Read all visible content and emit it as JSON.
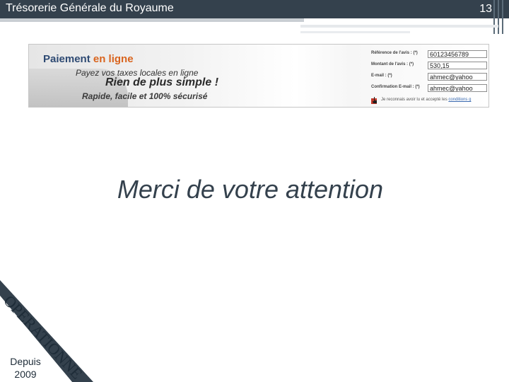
{
  "header": {
    "title": "Trésorerie Générale du Royaume",
    "page_number": "13"
  },
  "banner": {
    "title_main": "Paiement",
    "title_accent": "en ligne",
    "line1": "Payez vos taxes locales en ligne",
    "line2": "Rien de plus simple !",
    "line3": "Rapide, facile et 100% sécurisé",
    "form": {
      "fields": [
        {
          "label": "Référence de l'avis : (*)",
          "value": "60123456789"
        },
        {
          "label": "Montant de l'avis : (*)",
          "value": "530,15"
        },
        {
          "label": "E-mail : (*)",
          "value": "ahmec@yahoo"
        },
        {
          "label": "Confirmation E-mail : (*)",
          "value": "ahmec@yahoo"
        }
      ],
      "terms_text": "Je reconnais avoir lu et accepté les",
      "terms_link": "conditions g"
    }
  },
  "main": {
    "thanks": "Merci de votre attention"
  },
  "ribbon": {
    "text": "OPERATIONNEL",
    "since": "Depuis",
    "year": "2009",
    "color": "#34414d"
  },
  "colors": {
    "header_bg": "#34414d",
    "accent_orange": "#d9641e",
    "title_blue": "#2e4a73"
  }
}
